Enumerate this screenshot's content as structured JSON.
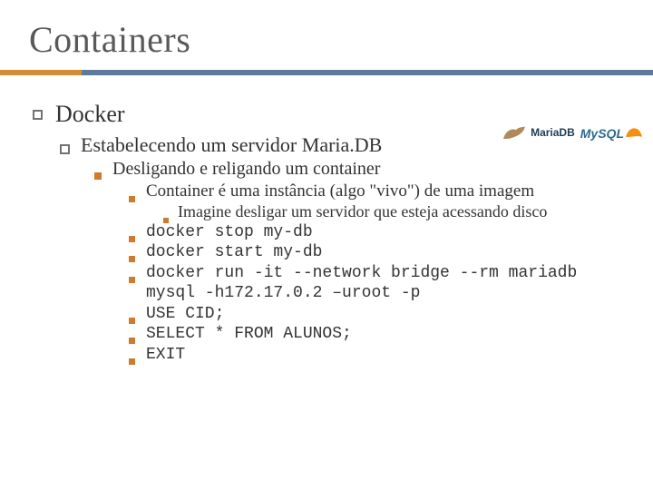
{
  "title": "Containers",
  "topic": "Docker",
  "subtopic": "Estabelecendo um servidor Maria.DB",
  "subsubtopic": "Desligando e religando um container",
  "body1": "Container é uma instância (algo \"vivo\") de uma imagem",
  "sub1": "Imagine desligar um servidor que esteja acessando disco",
  "cmd1": "docker stop my-db",
  "cmd2": "docker start my-db",
  "cmd3": "docker run -it --network bridge --rm mariadb mysql -h172.17.0.2 –uroot -p",
  "cmd4": "USE CID;",
  "cmd5": "SELECT * FROM ALUNOS;",
  "cmd6": "EXIT",
  "logos": {
    "mariadb": "MariaDB",
    "mysql": "MySQL"
  }
}
